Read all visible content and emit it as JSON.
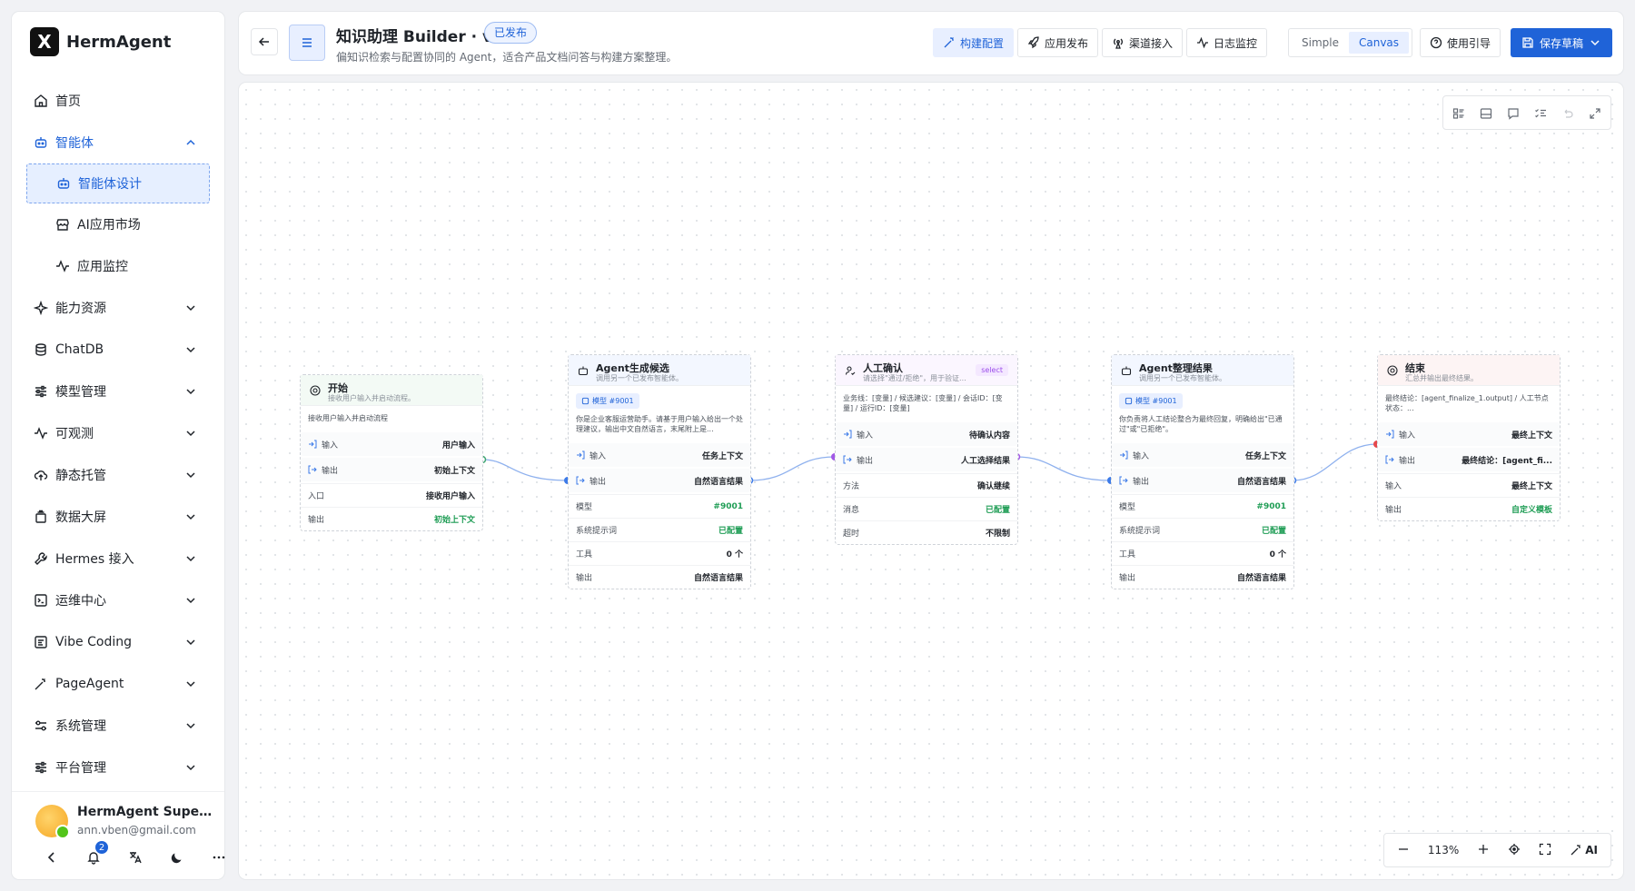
{
  "brand": {
    "name": "HermAgent",
    "logo_letter": "X"
  },
  "sidebar": {
    "items": [
      {
        "label": "首页",
        "icon": "home-icon"
      },
      {
        "label": "智能体",
        "icon": "robot-icon",
        "expanded": true
      },
      {
        "label": "智能体设计",
        "icon": "robot-icon",
        "sub": true,
        "selected": true
      },
      {
        "label": "AI应用市场",
        "icon": "store-icon",
        "sub": true
      },
      {
        "label": "应用监控",
        "icon": "activity-icon",
        "sub": true
      },
      {
        "label": "能力资源",
        "icon": "sparkle-icon"
      },
      {
        "label": "ChatDB",
        "icon": "database-icon"
      },
      {
        "label": "模型管理",
        "icon": "sliders-icon"
      },
      {
        "label": "可观测",
        "icon": "activity-icon"
      },
      {
        "label": "静态托管",
        "icon": "cloud-upload-icon"
      },
      {
        "label": "数据大屏",
        "icon": "layers-icon"
      },
      {
        "label": "Hermes 接入",
        "icon": "wrench-icon"
      },
      {
        "label": "运维中心",
        "icon": "terminal-icon"
      },
      {
        "label": "Vibe Coding",
        "icon": "code-icon"
      },
      {
        "label": "PageAgent",
        "icon": "wand-icon"
      },
      {
        "label": "系统管理",
        "icon": "settings-sliders-icon"
      },
      {
        "label": "平台管理",
        "icon": "sliders-icon"
      }
    ]
  },
  "user": {
    "name": "HermAgent Super ...",
    "email": "ann.vben@gmail.com",
    "notifications": "2"
  },
  "header": {
    "title": "知识助理 Builder · v8",
    "status": "已发布",
    "subtitle": "偏知识检索与配置协同的 Agent，适合产品文档问答与构建方案整理。",
    "tabs": [
      "构建配置",
      "应用发布",
      "渠道接入",
      "日志监控"
    ],
    "modes": [
      "Simple",
      "Canvas"
    ],
    "guide": "使用引导",
    "save": "保存草稿"
  },
  "zoom": {
    "level": "113%",
    "ai": "AI"
  },
  "nodes": {
    "start": {
      "title": "开始",
      "desc": "接收用户输入并启动流程。",
      "text": "接收用户输入并启动流程",
      "rows": [
        {
          "k": "输入",
          "v": "用户输入"
        },
        {
          "k": "输出",
          "v": "初始上下文"
        },
        {
          "k": "入口",
          "v": "接收用户输入"
        },
        {
          "k": "输出",
          "v": "初始上下文"
        }
      ]
    },
    "agent1": {
      "title": "Agent生成候选",
      "desc": "调用另一个已发布智能体。",
      "model": "模型 #9001",
      "text": "你是企业客服运营助手。请基于用户输入给出一个处理建议，输出中文自然语言，末尾附上是...",
      "rows": [
        {
          "k": "输入",
          "v": "任务上下文"
        },
        {
          "k": "输出",
          "v": "自然语言结果"
        },
        {
          "k": "模型",
          "v": "#9001"
        },
        {
          "k": "系统提示词",
          "v": "已配置"
        },
        {
          "k": "工具",
          "v": "0 个"
        },
        {
          "k": "输出",
          "v": "自然语言结果"
        }
      ]
    },
    "human": {
      "title": "人工确认",
      "desc": "请选择\"通过/拒绝\"，用于验证...",
      "tag": "select",
      "text": "业务线：[变量] / 候选建议：[变量] / 会话ID：[变量] / 运行ID：[变量]",
      "rows": [
        {
          "k": "输入",
          "v": "待确认内容"
        },
        {
          "k": "输出",
          "v": "人工选择结果"
        },
        {
          "k": "方法",
          "v": "确认继续"
        },
        {
          "k": "消息",
          "v": "已配置"
        },
        {
          "k": "超时",
          "v": "不限制"
        }
      ]
    },
    "agent2": {
      "title": "Agent整理结果",
      "desc": "调用另一个已发布智能体。",
      "model": "模型 #9001",
      "text": "你负责将人工结论整合为最终回复，明确给出\"已通过\"或\"已拒绝\"。",
      "rows": [
        {
          "k": "输入",
          "v": "任务上下文"
        },
        {
          "k": "输出",
          "v": "自然语言结果"
        },
        {
          "k": "模型",
          "v": "#9001"
        },
        {
          "k": "系统提示词",
          "v": "已配置"
        },
        {
          "k": "工具",
          "v": "0 个"
        },
        {
          "k": "输出",
          "v": "自然语言结果"
        }
      ]
    },
    "end": {
      "title": "结束",
      "desc": "汇总并输出最终结果。",
      "text": "最终结论：[agent_finalize_1.output] / 人工节点状态：...",
      "rows": [
        {
          "k": "输入",
          "v": "最终上下文"
        },
        {
          "k": "输出",
          "v": "最终结论：[agent_fi..."
        },
        {
          "k": "输入",
          "v": "最终上下文"
        },
        {
          "k": "输出",
          "v": "自定义模板"
        }
      ]
    }
  },
  "colors": {
    "accent": "#1f63d8",
    "green": "#1f9d55",
    "purple": "#9b4dea",
    "red": "#e5484d"
  }
}
